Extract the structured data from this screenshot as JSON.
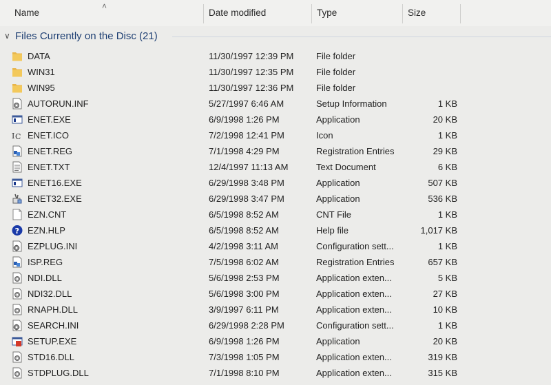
{
  "columns": {
    "name": "Name",
    "date": "Date modified",
    "type": "Type",
    "size": "Size"
  },
  "group": {
    "label": "Files Currently on the Disc (21)"
  },
  "icons": {
    "folder": "folder-icon",
    "inf": "setup-info-icon",
    "exe": "application-icon",
    "ico": "icon-file-icon",
    "reg": "registry-icon",
    "txt": "text-document-icon",
    "exe32": "application-installer-icon",
    "blank": "blank-file-icon",
    "hlp": "help-file-icon",
    "ini": "config-settings-icon",
    "dll": "dll-icon",
    "setup": "setup-exe-icon"
  },
  "files": [
    {
      "name": "DATA",
      "date": "11/30/1997 12:39 PM",
      "type": "File folder",
      "size": "",
      "icon": "folder"
    },
    {
      "name": "WIN31",
      "date": "11/30/1997 12:35 PM",
      "type": "File folder",
      "size": "",
      "icon": "folder"
    },
    {
      "name": "WIN95",
      "date": "11/30/1997 12:36 PM",
      "type": "File folder",
      "size": "",
      "icon": "folder"
    },
    {
      "name": "AUTORUN.INF",
      "date": "5/27/1997 6:46 AM",
      "type": "Setup Information",
      "size": "1 KB",
      "icon": "inf"
    },
    {
      "name": "ENET.EXE",
      "date": "6/9/1998 1:26 PM",
      "type": "Application",
      "size": "20 KB",
      "icon": "exe"
    },
    {
      "name": "ENET.ICO",
      "date": "7/2/1998 12:41 PM",
      "type": "Icon",
      "size": "1 KB",
      "icon": "ico"
    },
    {
      "name": "ENET.REG",
      "date": "7/1/1998 4:29 PM",
      "type": "Registration Entries",
      "size": "29 KB",
      "icon": "reg"
    },
    {
      "name": "ENET.TXT",
      "date": "12/4/1997 11:13 AM",
      "type": "Text Document",
      "size": "6 KB",
      "icon": "txt"
    },
    {
      "name": "ENET16.EXE",
      "date": "6/29/1998 3:48 PM",
      "type": "Application",
      "size": "507 KB",
      "icon": "exe"
    },
    {
      "name": "ENET32.EXE",
      "date": "6/29/1998 3:47 PM",
      "type": "Application",
      "size": "536 KB",
      "icon": "exe32"
    },
    {
      "name": "EZN.CNT",
      "date": "6/5/1998 8:52 AM",
      "type": "CNT File",
      "size": "1 KB",
      "icon": "blank"
    },
    {
      "name": "EZN.HLP",
      "date": "6/5/1998 8:52 AM",
      "type": "Help file",
      "size": "1,017 KB",
      "icon": "hlp"
    },
    {
      "name": "EZPLUG.INI",
      "date": "4/2/1998 3:11 AM",
      "type": "Configuration sett...",
      "size": "1 KB",
      "icon": "ini"
    },
    {
      "name": "ISP.REG",
      "date": "7/5/1998 6:02 AM",
      "type": "Registration Entries",
      "size": "657 KB",
      "icon": "reg"
    },
    {
      "name": "NDI.DLL",
      "date": "5/6/1998 2:53 PM",
      "type": "Application exten...",
      "size": "5 KB",
      "icon": "dll"
    },
    {
      "name": "NDI32.DLL",
      "date": "5/6/1998 3:00 PM",
      "type": "Application exten...",
      "size": "27 KB",
      "icon": "dll"
    },
    {
      "name": "RNAPH.DLL",
      "date": "3/9/1997 6:11 PM",
      "type": "Application exten...",
      "size": "10 KB",
      "icon": "dll"
    },
    {
      "name": "SEARCH.INI",
      "date": "6/29/1998 2:28 PM",
      "type": "Configuration sett...",
      "size": "1 KB",
      "icon": "ini"
    },
    {
      "name": "SETUP.EXE",
      "date": "6/9/1998 1:26 PM",
      "type": "Application",
      "size": "20 KB",
      "icon": "setup"
    },
    {
      "name": "STD16.DLL",
      "date": "7/3/1998 1:05 PM",
      "type": "Application exten...",
      "size": "319 KB",
      "icon": "dll"
    },
    {
      "name": "STDPLUG.DLL",
      "date": "7/1/1998 8:10 PM",
      "type": "Application exten...",
      "size": "315 KB",
      "icon": "dll"
    }
  ]
}
